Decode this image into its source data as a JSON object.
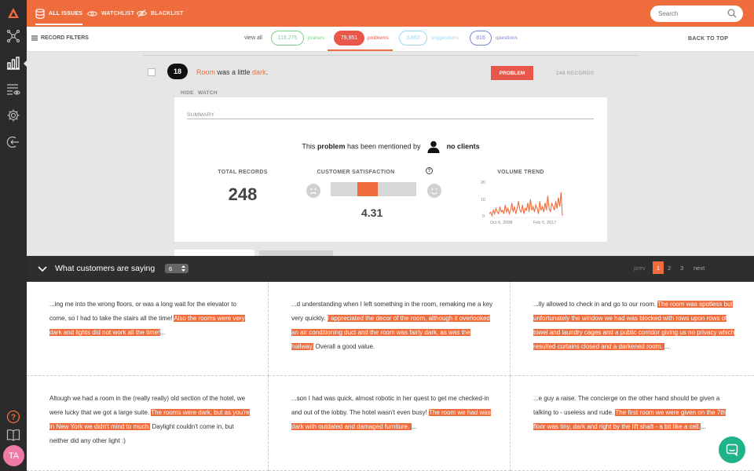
{
  "app": {
    "avatar_initials": "TA",
    "accent": "#ef6c3c"
  },
  "sidebar": {
    "items": [
      {
        "icon": "network-icon"
      },
      {
        "icon": "bar-chart-icon",
        "active": true
      },
      {
        "icon": "list-eye-icon"
      },
      {
        "icon": "gear-icon"
      },
      {
        "icon": "logout-icon"
      },
      {
        "icon": "help-icon"
      },
      {
        "icon": "book-icon"
      }
    ]
  },
  "topbar": {
    "tabs": [
      {
        "label": "ALL ISSUES",
        "icon": "database-icon",
        "active": true
      },
      {
        "label": "WATCHLIST",
        "icon": "eye-icon"
      },
      {
        "label": "BLACKLIST",
        "icon": "eye-slash-icon"
      }
    ],
    "search_placeholder": "Search"
  },
  "filterbar": {
    "record_filters": "RECORD FILTERS",
    "view_all": "view all",
    "praises": {
      "count": "119,275",
      "label": "praises",
      "color": "#7ccf8a"
    },
    "problems": {
      "count": "79,951",
      "label": "problems",
      "color": "#e8574a"
    },
    "suggestions": {
      "count": "3,863",
      "label": "suggestions",
      "color": "#9fd6ee"
    },
    "questions": {
      "count": "816",
      "label": "questions",
      "color": "#7a86d6"
    },
    "back_to_top": "BACK TO TOP"
  },
  "issue": {
    "number": "18",
    "text_parts": [
      "Room",
      " was a little ",
      "dark",
      "."
    ],
    "type_button": "PROBLEM",
    "records": "248 RECORDS",
    "hide": "HIDE",
    "watch": "WATCH"
  },
  "summary": {
    "title": "SUMMARY",
    "mention_pre": "This ",
    "mention_type": "problem",
    "mention_mid": " has been mentioned by",
    "mention_clients": "no clients",
    "total_records_label": "TOTAL RECORDS",
    "total_records": "248",
    "satisfaction_label": "CUSTOMER SATISFACTION",
    "satisfaction": "4.31",
    "help": "?",
    "volume_label": "VOLUME TREND",
    "volume_y_ticks": [
      "20",
      "10",
      "0"
    ],
    "volume_x_ticks": [
      "Oct 6, 2008",
      "Feb 5, 2017"
    ]
  },
  "chart_data": {
    "type": "line",
    "title": "VOLUME TREND",
    "x": [
      "Oct 6, 2008",
      "Feb 5, 2017"
    ],
    "ylim": [
      0,
      20
    ],
    "values": [
      2,
      3,
      1,
      4,
      2,
      5,
      3,
      2,
      6,
      3,
      4,
      2,
      7,
      3,
      5,
      2,
      4,
      8,
      3,
      6,
      2,
      5,
      9,
      4,
      3,
      7,
      2,
      5,
      4,
      8,
      3,
      10,
      4,
      6,
      3,
      7,
      5,
      2,
      9,
      4,
      6,
      3,
      8,
      4,
      12,
      5,
      3,
      8,
      6,
      4,
      9,
      5,
      11,
      6,
      14,
      1
    ]
  },
  "quotes": {
    "title": "What customers are saying",
    "per_page": "6",
    "pagination": {
      "prev": "prev",
      "pages": [
        "1",
        "2",
        "3"
      ],
      "next": "next"
    },
    "cells": [
      {
        "pre": "...ing me into the wrong floors, or was a long wait for the elevator to come, so I had to take the stairs all the time! ",
        "hl": "Also the rooms were very dark and lights did not work all the time!",
        "post": "..."
      },
      {
        "pre": "...d understanding when I left something in the room, remaking me a key very quickly. ",
        "hl": "I appreciated the decor of the room, although it overlooked an air conditioning duct and the room was fairly dark, as was the hallway.",
        "post": " Overall a good value."
      },
      {
        "pre": "...lly allowed to check in and go to our room. ",
        "hl": "The room was spotless but unfortunately the window we had was blocked with rows upon rows of towel and laundry cages and a public corridor giving us no privacy which resulted curtains closed and a darkened room. ",
        "post": "..."
      },
      {
        "pre": "Altough we had a room in the (really really) old section of the hotel, we were lucky that we got a large suite. ",
        "hl": "The rooms were dark, but as you're in New York we didn't mind to much.",
        "post": " Daylight couldn't come in, but neither did any other light :)"
      },
      {
        "pre": "...son I had was quick, almost robotic in her quest to get me checked-in and out of the lobby. The hotel wasn't even busy! ",
        "hl": "The room we had was dark with outdated and damaged furniture. ",
        "post": "..."
      },
      {
        "pre": "...e guy a raise. The concierge on the other hand should be given a talking to - useless and rude. ",
        "hl": "The first room we were given on the 7th floor was tiny, dark and right by the lift shaft - a bit like a cell.",
        "post": "..."
      }
    ]
  }
}
